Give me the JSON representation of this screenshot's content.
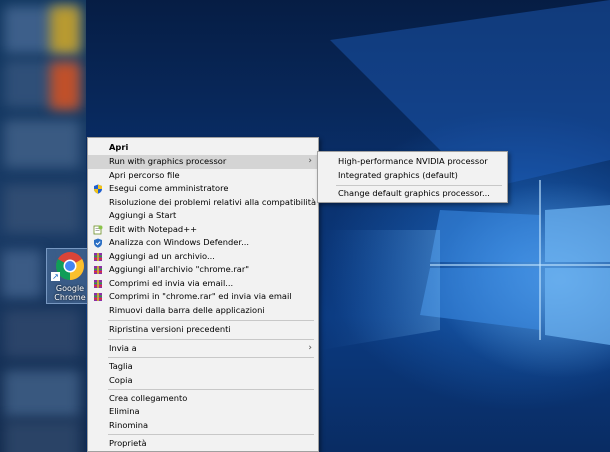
{
  "desktop": {
    "icon": {
      "label_line1": "Google",
      "label_line2": "Chrome",
      "icon": "chrome-logo-icon"
    },
    "colors": {
      "wallpaper_dark": "#061d44",
      "wallpaper_light": "#5fb2ff",
      "menu_bg": "#f2f2f2",
      "menu_highlight": "#d4d4d4"
    }
  },
  "context_menu": {
    "items": [
      {
        "label": "Apri",
        "bold": true,
        "icon": ""
      },
      {
        "label": "Run with graphics processor",
        "has_submenu": true,
        "highlighted": true,
        "icon": ""
      },
      {
        "label": "Apri percorso file",
        "icon": ""
      },
      {
        "label": "Esegui come amministratore",
        "icon": "shield-icon"
      },
      {
        "label": "Risoluzione dei problemi relativi alla compatibilità",
        "icon": ""
      },
      {
        "label": "Aggiungi a Start",
        "icon": ""
      },
      {
        "label": "Edit with Notepad++",
        "icon": "notepad-plus-plus-icon"
      },
      {
        "label": "Analizza con Windows Defender...",
        "icon": "windows-defender-icon"
      },
      {
        "label": "Aggiungi ad un archivio...",
        "icon": "winrar-icon"
      },
      {
        "label": "Aggiungi all'archivio \"chrome.rar\"",
        "icon": "winrar-icon"
      },
      {
        "label": "Comprimi ed invia via email...",
        "icon": "winrar-icon"
      },
      {
        "label": "Comprimi in \"chrome.rar\" ed invia via email",
        "icon": "winrar-icon"
      },
      {
        "label": "Rimuovi dalla barra delle applicazioni",
        "icon": ""
      },
      {
        "label": "Ripristina versioni precedenti",
        "icon": ""
      },
      {
        "label": "Invia a",
        "has_submenu": true,
        "icon": ""
      },
      {
        "label": "Taglia",
        "icon": ""
      },
      {
        "label": "Copia",
        "icon": ""
      },
      {
        "label": "Crea collegamento",
        "icon": ""
      },
      {
        "label": "Elimina",
        "icon": ""
      },
      {
        "label": "Rinomina",
        "icon": ""
      },
      {
        "label": "Proprietà",
        "icon": ""
      }
    ]
  },
  "submenu": {
    "items": [
      {
        "label": "High-performance NVIDIA processor"
      },
      {
        "label": "Integrated graphics (default)"
      },
      {
        "label": "Change default graphics processor..."
      }
    ]
  }
}
